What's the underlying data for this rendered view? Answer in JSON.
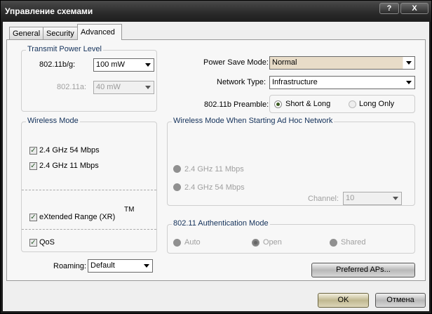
{
  "window": {
    "title": "Управление схемами",
    "help_label": "?",
    "close_label": "X"
  },
  "tabs": [
    {
      "label": "General"
    },
    {
      "label": "Security"
    },
    {
      "label": "Advanced",
      "active": true
    }
  ],
  "transmit_power": {
    "title": "Transmit Power Level",
    "bg_label": "802.11b/g:",
    "bg_value": "100 mW",
    "a_label": "802.11a:",
    "a_value": "40 mW"
  },
  "power_save": {
    "label": "Power Save Mode:",
    "value": "Normal"
  },
  "network_type": {
    "label": "Network Type:",
    "value": "Infrastructure"
  },
  "preamble": {
    "label": "802.11b Preamble:",
    "options": [
      {
        "label": "Short & Long",
        "selected": true
      },
      {
        "label": "Long Only",
        "selected": false
      }
    ]
  },
  "wireless_mode": {
    "title": "Wireless Mode",
    "items": [
      {
        "label": "2.4 GHz 54 Mbps",
        "checked": true
      },
      {
        "label": "2.4 GHz 11 Mbps",
        "checked": true
      }
    ],
    "xr_label": "eXtended Range (XR)",
    "xr_checked": true,
    "tm": "TM",
    "qos_label": "QoS",
    "qos_checked": true
  },
  "roaming": {
    "label": "Roaming:",
    "value": "Default"
  },
  "adhoc": {
    "title": "Wireless Mode When Starting Ad Hoc Network",
    "options": [
      {
        "label": "2.4 GHz 11 Mbps"
      },
      {
        "label": "2.4 GHz 54 Mbps"
      }
    ],
    "channel_label": "Channel:",
    "channel_value": "10"
  },
  "auth": {
    "title": "802.11 Authentication Mode",
    "options": [
      {
        "label": "Auto",
        "selected": false
      },
      {
        "label": "Open",
        "selected": true
      },
      {
        "label": "Shared",
        "selected": false
      }
    ]
  },
  "buttons": {
    "preferred": "Preferred APs...",
    "ok": "OK",
    "cancel": "Отмена"
  },
  "colors": {
    "titlebar": "#2a2a2a",
    "panel": "#f7f7f7",
    "group_title": "#13315a",
    "power_save_bg": "#e8dcc8"
  }
}
